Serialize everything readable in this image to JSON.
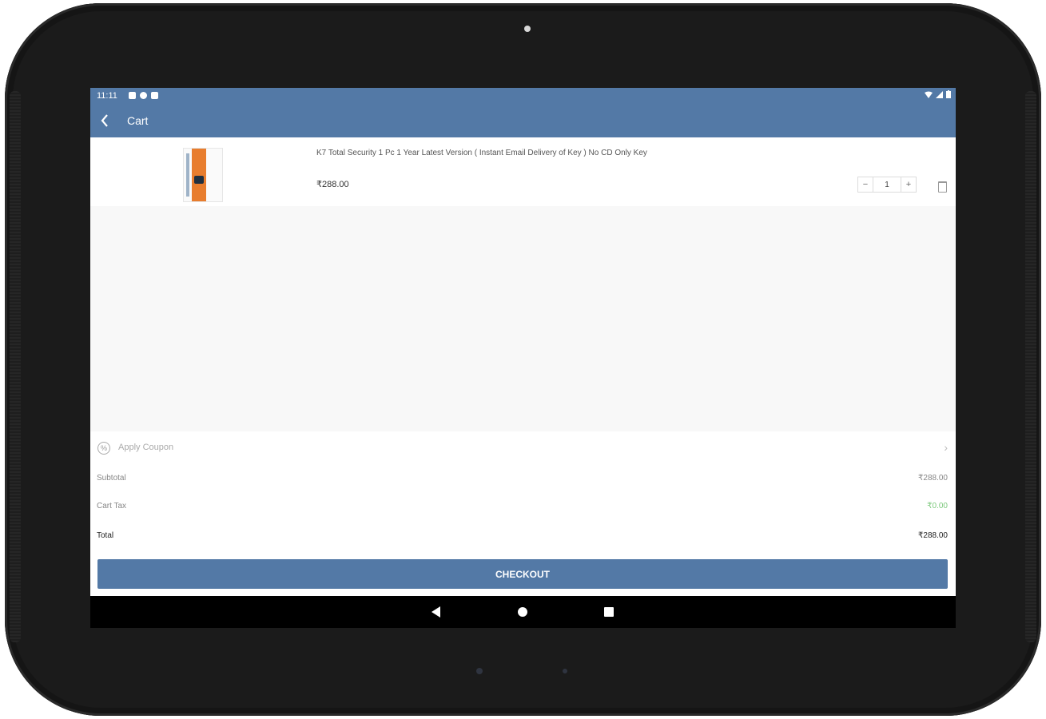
{
  "status_bar": {
    "time": "11:11"
  },
  "app_bar": {
    "back_icon": "chevron-left-icon",
    "title": "Cart"
  },
  "cart_item": {
    "name": "K7 Total Security 1 Pc 1 Year Latest Version ( Instant Email Delivery of Key ) No CD Only Key",
    "price": "₹288.00",
    "quantity": "1",
    "minus_label": "−",
    "plus_label": "+"
  },
  "coupon": {
    "label": "Apply Coupon",
    "icon": "percent-icon",
    "chevron": "›"
  },
  "summary": {
    "subtotal_label": "Subtotal",
    "subtotal_value": "₹288.00",
    "tax_label": "Cart Tax",
    "tax_value": "₹0.00",
    "total_label": "Total",
    "total_value": "₹288.00"
  },
  "checkout_label": "CHECKOUT",
  "colors": {
    "primary": "#5379a6",
    "tax_green": "#7dc97d",
    "background": "#f8f8f8"
  }
}
